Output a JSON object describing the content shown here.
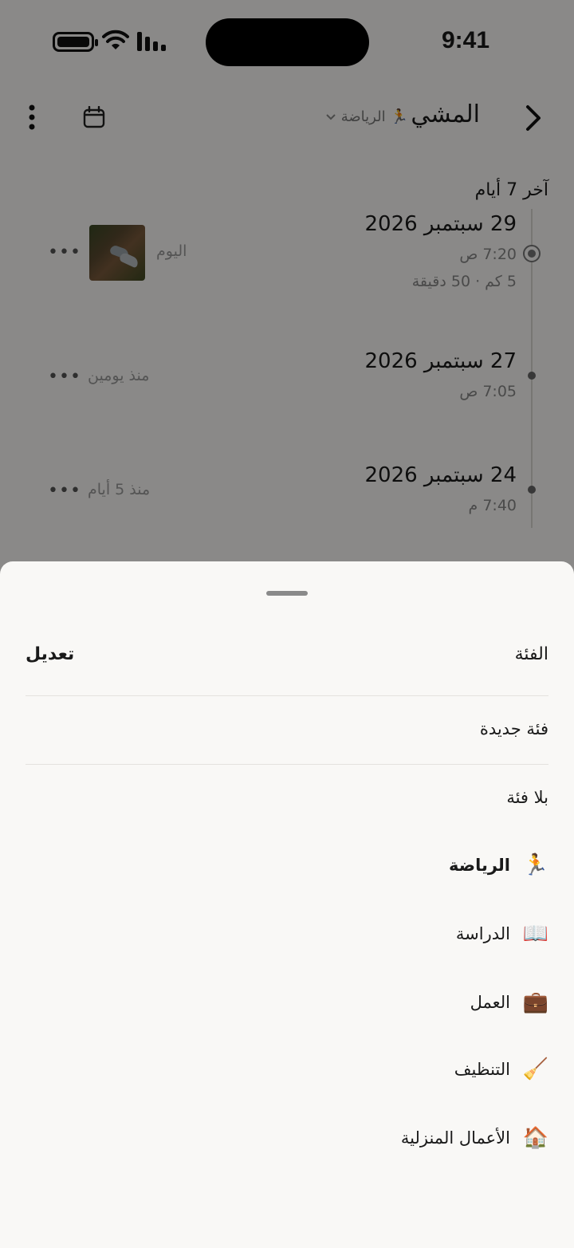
{
  "status_bar": {
    "time": "9:41"
  },
  "header": {
    "title": "المشي",
    "category_chip": {
      "emoji": "🏃",
      "label": "الرياضة"
    }
  },
  "section_label": "آخر 7 أيام",
  "entries": [
    {
      "date": "29 سبتمبر 2026",
      "time": "7:20 ص",
      "meta": "5 كم · 50 دقيقة",
      "relative": "اليوم",
      "has_photo": true
    },
    {
      "date": "27 سبتمبر 2026",
      "time": "7:05 ص",
      "relative": "منذ يومين"
    },
    {
      "date": "24 سبتمبر 2026",
      "time": "7:40 م",
      "relative": "منذ 5 أيام"
    }
  ],
  "sheet": {
    "title": "الفئة",
    "edit_label": "تعديل",
    "new_category": "فئة جديدة",
    "no_category": "بلا فئة",
    "categories": [
      {
        "emoji": "🏃",
        "label": "الرياضة",
        "selected": true
      },
      {
        "emoji": "📖",
        "label": "الدراسة"
      },
      {
        "emoji": "💼",
        "label": "العمل"
      },
      {
        "emoji": "🧹",
        "label": "التنظيف"
      },
      {
        "emoji": "🏠",
        "label": "الأعمال المنزلية"
      }
    ]
  }
}
